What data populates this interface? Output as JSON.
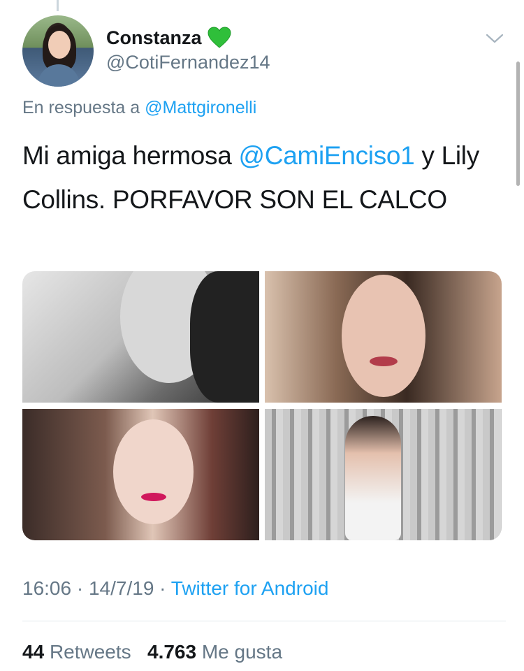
{
  "user": {
    "display_name": "Constanza",
    "handle": "@CotiFernandez14",
    "badge_icon": "green-heart-icon",
    "accent_color": "#1da1f2"
  },
  "reply": {
    "prefix": "En respuesta a",
    "mention": "@Mattgironelli"
  },
  "tweet": {
    "text_before": "Mi amiga hermosa ",
    "mention": "@CamiEnciso1",
    "text_after": " y Lily Collins. PORFAVOR SON EL CALCO"
  },
  "meta": {
    "time": "16:06",
    "date": "14/7/19",
    "source": "Twitter for Android"
  },
  "stats": {
    "retweets_count": "44",
    "retweets_label": "Retweets",
    "likes_count": "4.763",
    "likes_label": "Me gusta"
  }
}
